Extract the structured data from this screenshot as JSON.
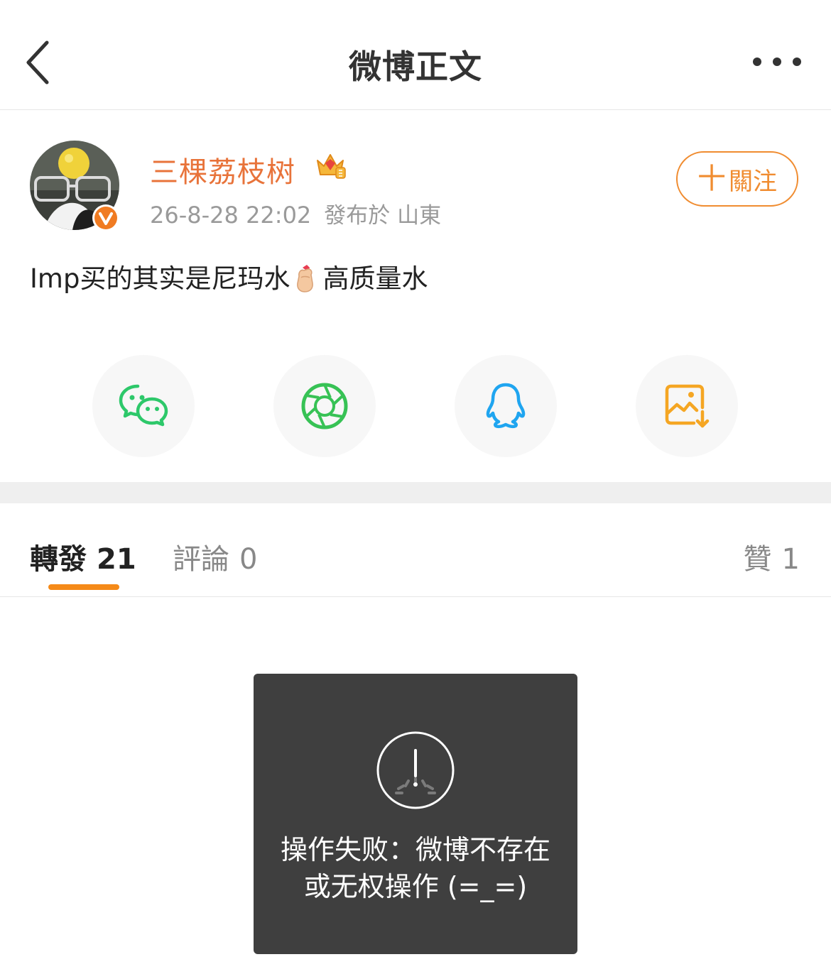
{
  "header": {
    "title": "微博正文",
    "back_icon": "chevron-left-icon",
    "more_icon": "more-horizontal-icon"
  },
  "post": {
    "author": "三棵荔枝树",
    "timestamp": "26-8-28 22:02",
    "location": "發布於 山東",
    "follow_label": "關注",
    "follow_plus": "十",
    "text_before": "Imp买的其实是尼玛水",
    "text_after": "高质量水"
  },
  "share": {
    "items": [
      {
        "icon": "wechat-icon",
        "color": "#2dc86a"
      },
      {
        "icon": "moments-icon",
        "color": "#37c255"
      },
      {
        "icon": "qq-icon",
        "color": "#1fa5f0"
      },
      {
        "icon": "save-image-icon",
        "color": "#f5a623"
      }
    ]
  },
  "tabs": {
    "repost_label": "轉發",
    "repost_count": "21",
    "comment_label": "評論",
    "comment_count": "0",
    "like_label": "贊",
    "like_count": "1"
  },
  "toast": {
    "icon": "exclamation-icon",
    "message": "操作失败：微博不存在或无权操作 (=_=)"
  },
  "colors": {
    "accent": "#f08c30",
    "username": "#e8733a",
    "tab_indicator": "#f58a18",
    "toast_bg": "#3f3f3f"
  }
}
